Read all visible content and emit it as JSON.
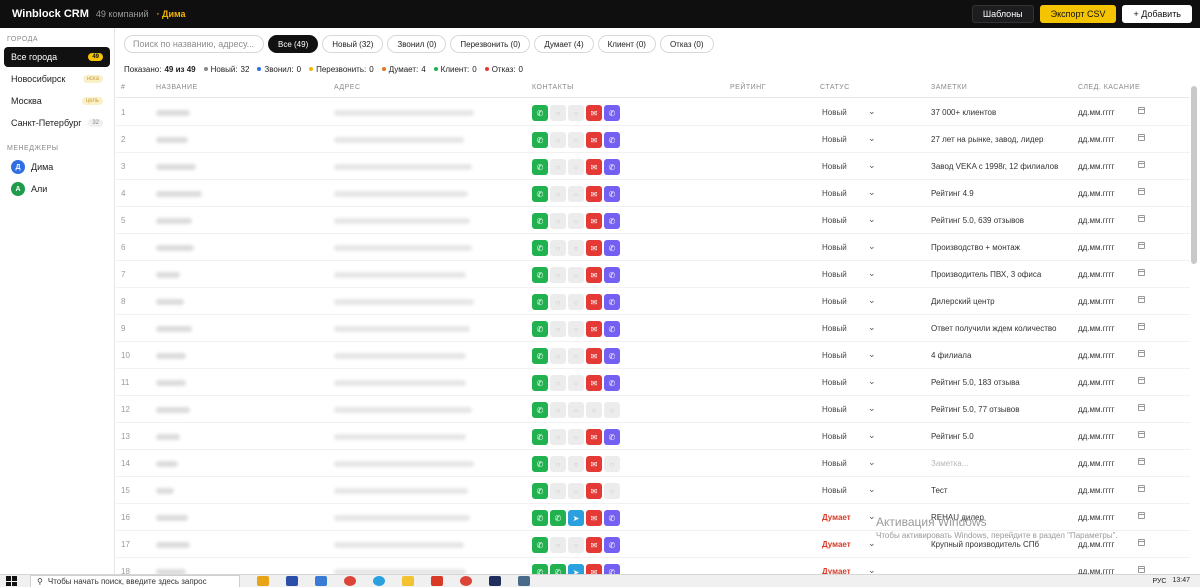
{
  "app": {
    "title": "Winblock CRM",
    "company_count": "49 компаний",
    "current_user": "· Дима"
  },
  "top_actions": {
    "templates": "Шаблоны",
    "export": "Экспорт CSV",
    "add": "+ Добавить"
  },
  "sidebar": {
    "cities_title": "ГОРОДА",
    "cities": [
      {
        "label": "Все города",
        "badge": "49",
        "active": true
      },
      {
        "label": "Новосибирск",
        "badge": "нска"
      },
      {
        "label": "Москва",
        "badge": "цель"
      },
      {
        "label": "Санкт-Петербург",
        "badge": "32"
      }
    ],
    "managers_title": "МЕНЕДЖЕРЫ",
    "managers": [
      {
        "initial": "Д",
        "name": "Дима",
        "color": "#2f6fe4"
      },
      {
        "initial": "А",
        "name": "Али",
        "color": "#1f9d4c"
      }
    ]
  },
  "search": {
    "placeholder": "Поиск по названию, адресу..."
  },
  "filters": [
    {
      "label": "Все (49)",
      "active": true
    },
    {
      "label": "Новый (32)"
    },
    {
      "label": "Звонил (0)"
    },
    {
      "label": "Перезвонить (0)"
    },
    {
      "label": "Думает (4)"
    },
    {
      "label": "Клиент (0)"
    },
    {
      "label": "Отказ (0)"
    }
  ],
  "stats": {
    "shown_label": "Показано:",
    "shown_value": "49 из 49",
    "items": [
      {
        "label": "Новый:",
        "value": "32",
        "color": "#888888"
      },
      {
        "label": "Звонил:",
        "value": "0",
        "color": "#2f6fe4"
      },
      {
        "label": "Перезвонить:",
        "value": "0",
        "color": "#f5b400"
      },
      {
        "label": "Думает:",
        "value": "4",
        "color": "#e8731e"
      },
      {
        "label": "Клиент:",
        "value": "0",
        "color": "#21b24f"
      },
      {
        "label": "Отказ:",
        "value": "0",
        "color": "#e53935"
      }
    ]
  },
  "table": {
    "columns": {
      "num": "#",
      "name": "НАЗВАНИЕ",
      "address": "АДРЕС",
      "contacts": "КОНТАКТЫ",
      "rating": "РЕЙТИНГ",
      "status": "СТАТУС",
      "notes": "ЗАМЕТКИ",
      "next": "СЛЕД. КАСАНИЕ"
    },
    "rows": [
      {
        "num": "1",
        "status": "Новый",
        "note": "37 000+ клиентов",
        "date": "дд.мм.гггг"
      },
      {
        "num": "2",
        "status": "Новый",
        "note": "27 лет на рынке, завод, лидер",
        "date": "дд.мм.гггг"
      },
      {
        "num": "3",
        "status": "Новый",
        "note": "Завод VEKA с 1998г, 12 филиалов",
        "date": "дд.мм.гггг"
      },
      {
        "num": "4",
        "status": "Новый",
        "note": "Рейтинг 4.9",
        "date": "дд.мм.гггг"
      },
      {
        "num": "5",
        "status": "Новый",
        "note": "Рейтинг 5.0, 639 отзывов",
        "date": "дд.мм.гггг"
      },
      {
        "num": "6",
        "status": "Новый",
        "note": "Производство + монтаж",
        "date": "дд.мм.гггг"
      },
      {
        "num": "7",
        "status": "Новый",
        "note": "Производитель ПВХ, 3 офиса",
        "date": "дд.мм.гггг"
      },
      {
        "num": "8",
        "status": "Новый",
        "note": "Дилерский центр",
        "date": "дд.мм.гггг"
      },
      {
        "num": "9",
        "status": "Новый",
        "note": "Ответ получили ждем количество",
        "date": "дд.мм.гггг"
      },
      {
        "num": "10",
        "status": "Новый",
        "note": "4 филиала",
        "date": "дд.мм.гггг"
      },
      {
        "num": "11",
        "status": "Новый",
        "note": "Рейтинг 5.0, 183 отзыва",
        "date": "дд.мм.гггг"
      },
      {
        "num": "12",
        "status": "Новый",
        "note": "Рейтинг 5.0, 77 отзывов",
        "date": "дд.мм.гггг"
      },
      {
        "num": "13",
        "status": "Новый",
        "note": "Рейтинг 5.0",
        "date": "дд.мм.гггг"
      },
      {
        "num": "14",
        "status": "Новый",
        "note": "Заметка...",
        "date": "дд.мм.гггг"
      },
      {
        "num": "15",
        "status": "Новый",
        "note": "Тест",
        "date": "дд.мм.гггг"
      },
      {
        "num": "16",
        "status": "Думает",
        "note": "REHAU дилер",
        "date": "дд.мм.гггг"
      },
      {
        "num": "17",
        "status": "Думает",
        "note": "Крупный производитель СПб",
        "date": "дд.мм.гггг"
      },
      {
        "num": "18",
        "status": "Думает",
        "note": "",
        "date": "дд.мм.гггг"
      }
    ]
  },
  "watermark": {
    "title": "Активация Windows",
    "subtitle": "Чтобы активировать Windows, перейдите в раздел \"Параметры\"."
  },
  "taskbar": {
    "search_placeholder": "Чтобы начать поиск, введите здесь запрос",
    "lang": "РУС",
    "time": "13:47"
  }
}
